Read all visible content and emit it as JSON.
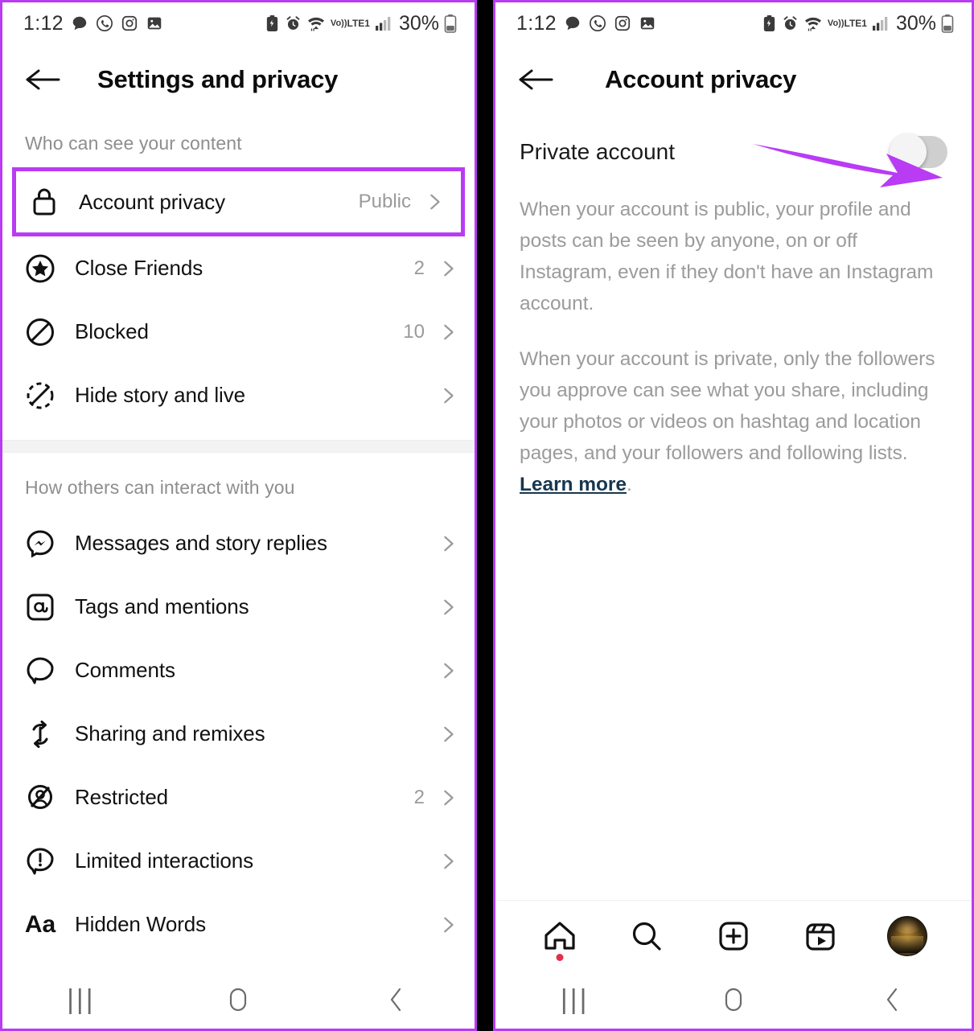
{
  "theme": {
    "accent_purple": "#b93bf4",
    "link_blue": "#18364f",
    "muted_text": "#9b9b9b",
    "notification_dot": "#e0314b"
  },
  "status_bar": {
    "time": "1:12",
    "battery_percent": "30%",
    "network_label": "LTE1",
    "volte_label": "Vo))",
    "left_icons": [
      "chat-bubble-icon",
      "whatsapp-icon",
      "instagram-icon",
      "gallery-icon"
    ],
    "right_icons": [
      "battery-saver-icon",
      "alarm-icon",
      "wifi-icon",
      "volte-icon",
      "signal-bars-icon",
      "battery-icon"
    ]
  },
  "left_panel": {
    "header": {
      "back": "back-arrow-icon",
      "title": "Settings and privacy"
    },
    "sections": [
      {
        "label": "Who can see your content",
        "items": [
          {
            "icon": "lock-icon",
            "label": "Account privacy",
            "value": "Public",
            "highlighted": true
          },
          {
            "icon": "close-friends-star-icon",
            "label": "Close Friends",
            "value": "2",
            "highlighted": false
          },
          {
            "icon": "blocked-icon",
            "label": "Blocked",
            "value": "10",
            "highlighted": false
          },
          {
            "icon": "hide-story-icon",
            "label": "Hide story and live",
            "value": "",
            "highlighted": false
          }
        ]
      },
      {
        "label": "How others can interact with you",
        "items": [
          {
            "icon": "messenger-icon",
            "label": "Messages and story replies",
            "value": "",
            "highlighted": false
          },
          {
            "icon": "at-mention-icon",
            "label": "Tags and mentions",
            "value": "",
            "highlighted": false
          },
          {
            "icon": "comment-icon",
            "label": "Comments",
            "value": "",
            "highlighted": false
          },
          {
            "icon": "remix-icon",
            "label": "Sharing and remixes",
            "value": "",
            "highlighted": false
          },
          {
            "icon": "restricted-icon",
            "label": "Restricted",
            "value": "2",
            "highlighted": false
          },
          {
            "icon": "limited-interactions-icon",
            "label": "Limited interactions",
            "value": "",
            "highlighted": false
          },
          {
            "icon": "hidden-words-icon",
            "label": "Hidden Words",
            "value": "",
            "highlighted": false
          }
        ]
      }
    ]
  },
  "right_panel": {
    "header": {
      "back": "back-arrow-icon",
      "title": "Account privacy"
    },
    "private_account": {
      "label": "Private account",
      "toggle_state": "off",
      "annotation": "purple-arrow-pointing-to-toggle"
    },
    "description": {
      "paragraph_1": "When your account is public, your profile and posts can be seen by anyone, on or off Instagram, even if they don't have an Instagram account.",
      "paragraph_2_before_link": "When your account is private, only the followers you approve can see what you share, including your photos or videos on hashtag and location pages, and your followers and following lists. ",
      "link_text": "Learn more",
      "paragraph_2_after_link": "."
    },
    "bottom_nav": [
      {
        "icon": "home-icon",
        "badge": true
      },
      {
        "icon": "search-icon",
        "badge": false
      },
      {
        "icon": "create-plus-icon",
        "badge": false
      },
      {
        "icon": "reels-icon",
        "badge": false
      },
      {
        "icon": "profile-avatar-icon",
        "badge": false
      }
    ]
  },
  "system_nav": {
    "recents": "|||",
    "home": "home-circle-icon",
    "back": "back-chevron-icon"
  }
}
